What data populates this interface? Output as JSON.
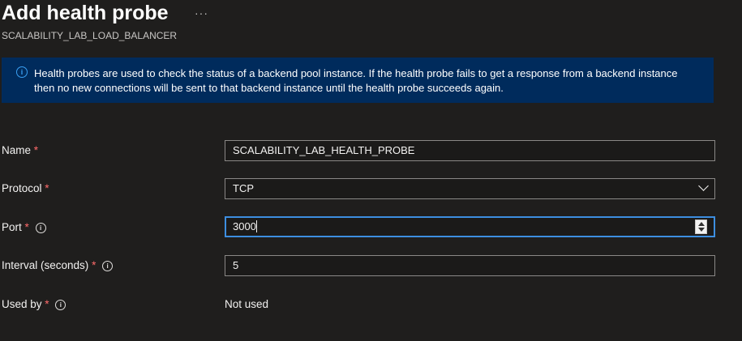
{
  "header": {
    "title": "Add health probe",
    "more_label": "···",
    "subtitle": "SCALABILITY_LAB_LOAD_BALANCER"
  },
  "info_banner": {
    "icon": "info-icon",
    "line1": "Health probes are used to check the status of a backend pool instance. If the health probe fails to get a response from a backend instance",
    "line2": "then no new connections will be sent to that backend instance until the health probe succeeds again."
  },
  "form": {
    "name": {
      "label": "Name",
      "required_mark": "*",
      "value": "SCALABILITY_LAB_HEALTH_PROBE"
    },
    "protocol": {
      "label": "Protocol",
      "required_mark": "*",
      "selected": "TCP"
    },
    "port": {
      "label": "Port",
      "required_mark": "*",
      "info_glyph": "i",
      "value": "3000"
    },
    "interval": {
      "label": "Interval (seconds)",
      "required_mark": "*",
      "info_glyph": "i",
      "value": "5"
    },
    "used_by": {
      "label": "Used by",
      "required_mark": "*",
      "info_glyph": "i",
      "value": "Not used"
    }
  },
  "colors": {
    "background": "#1f1e1d",
    "banner": "#002b5c",
    "accent_focus": "#3d8ee0",
    "required": "#ff6b6b"
  }
}
